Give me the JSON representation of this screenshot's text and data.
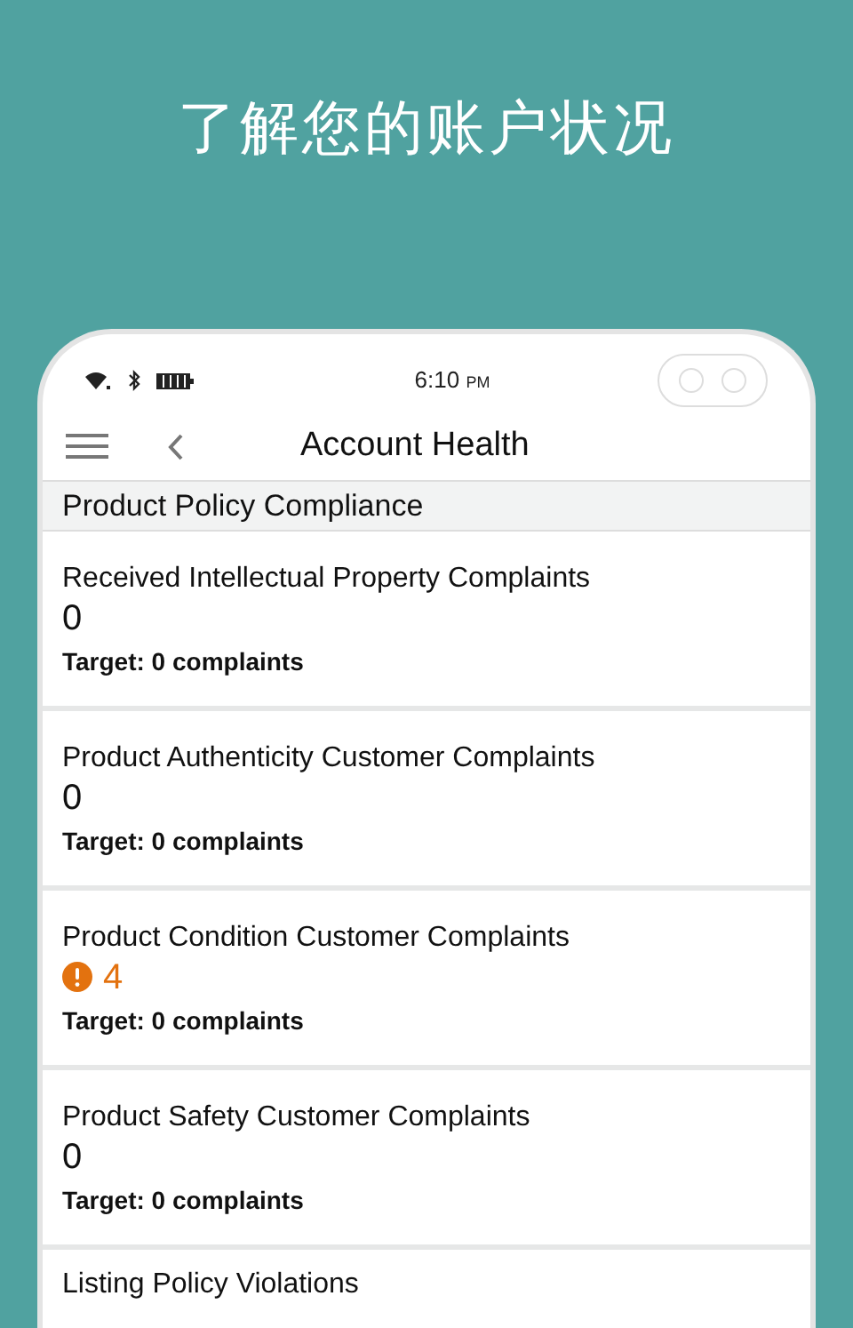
{
  "headline": "了解您的账户状况",
  "status_bar": {
    "time": "6:10",
    "ampm": "PM"
  },
  "nav": {
    "title": "Account Health"
  },
  "section": {
    "title": "Product Policy Compliance"
  },
  "items": [
    {
      "title": "Received Intellectual Property Complaints",
      "value": "0",
      "warning": false,
      "target": "Target: 0 complaints"
    },
    {
      "title": "Product Authenticity Customer Complaints",
      "value": "0",
      "warning": false,
      "target": "Target: 0 complaints"
    },
    {
      "title": "Product Condition Customer Complaints",
      "value": "4",
      "warning": true,
      "target": "Target: 0 complaints"
    },
    {
      "title": "Product Safety Customer Complaints",
      "value": "0",
      "warning": false,
      "target": "Target: 0 complaints"
    },
    {
      "title": "Listing Policy Violations"
    }
  ]
}
